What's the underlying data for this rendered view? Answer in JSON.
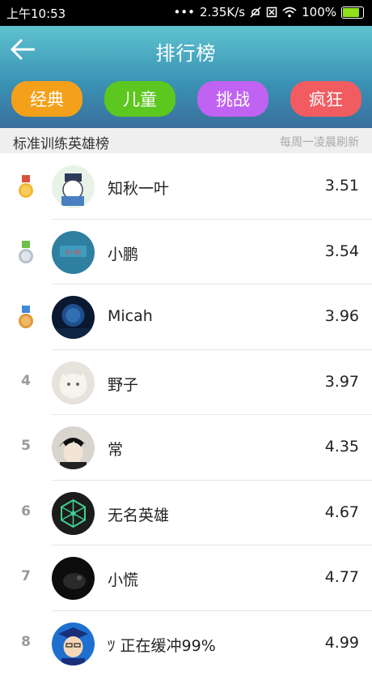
{
  "status_bar": {
    "time": "上午10:53",
    "network_speed": "2.35K/s",
    "battery": "100%"
  },
  "header": {
    "title": "排行榜",
    "tabs": [
      {
        "label": "经典",
        "color": "#f5a01a"
      },
      {
        "label": "儿童",
        "color": "#5cc71e"
      },
      {
        "label": "挑战",
        "color": "#c063f2"
      },
      {
        "label": "疯狂",
        "color": "#f15c60"
      }
    ]
  },
  "leaderboard": {
    "title": "标准训练英雄榜",
    "refresh_note": "每周一凌晨刷新",
    "entries": [
      {
        "rank": "",
        "medal": "gold-medal-icon",
        "name": "知秋一叶",
        "score": "3.51"
      },
      {
        "rank": "",
        "medal": "silver-medal-icon",
        "name": "小鹏",
        "score": "3.54"
      },
      {
        "rank": "",
        "medal": "bronze-medal-icon",
        "name": "Micah",
        "score": "3.96"
      },
      {
        "rank": "4",
        "name": "野子",
        "score": "3.97"
      },
      {
        "rank": "5",
        "name": "常",
        "score": "4.35"
      },
      {
        "rank": "6",
        "name": "无名英雄",
        "score": "4.67"
      },
      {
        "rank": "7",
        "name": "小慌",
        "score": "4.77"
      },
      {
        "rank": "8",
        "name": "ﾂ 正在缓冲99%",
        "score": "4.99"
      }
    ]
  },
  "colors": {
    "header_gradient_top": "#5fc3cf",
    "header_gradient_bottom": "#3a6f9c",
    "status_bar": "#000000"
  }
}
